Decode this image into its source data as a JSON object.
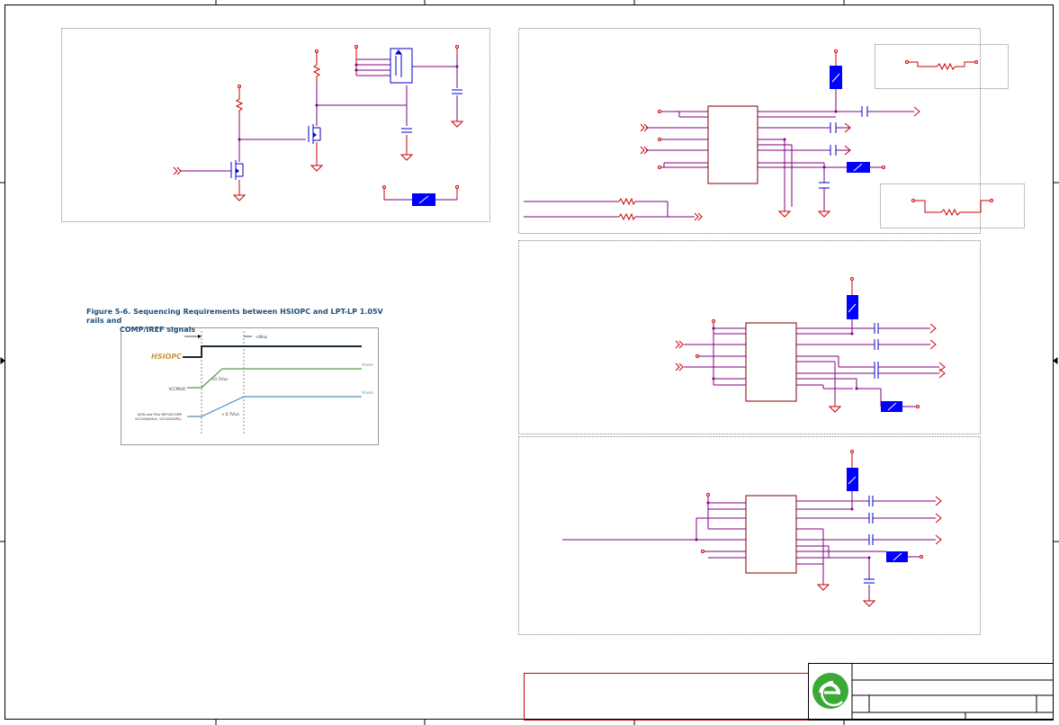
{
  "figure": {
    "title_line1": "Figure 5-6. Sequencing Requirements between HSIOPC and LPT-LP 1.05V rails and",
    "title_line2": "COMP/IREF signals",
    "hsiopc_label": "HSIOPC",
    "delay_label": "<80us",
    "rail1_label": "VCCMSIO",
    "rail1_right": "Vnom",
    "rail1_slew": "<0.7V/us",
    "rail2_label_line1": "SATA and PCIe REFUSCOMP",
    "rail2_label_line2": "VCCUSBUHUL, VCCSATA3PLL",
    "rail2_right": "Vnom",
    "rail2_slew": "< 0.7V/us"
  },
  "colors": {
    "wire": "#800080",
    "component": "#cc0000",
    "part_fill": "#0000ff",
    "frame": "#a0a0a0",
    "logo": "#3aa935",
    "fig_title": "#1f4e79",
    "hsiopc_text": "#c8963c",
    "rail1": "#5a9a46",
    "rail2": "#4a90c8"
  },
  "icons": {
    "logo": "company-logo-icon"
  }
}
